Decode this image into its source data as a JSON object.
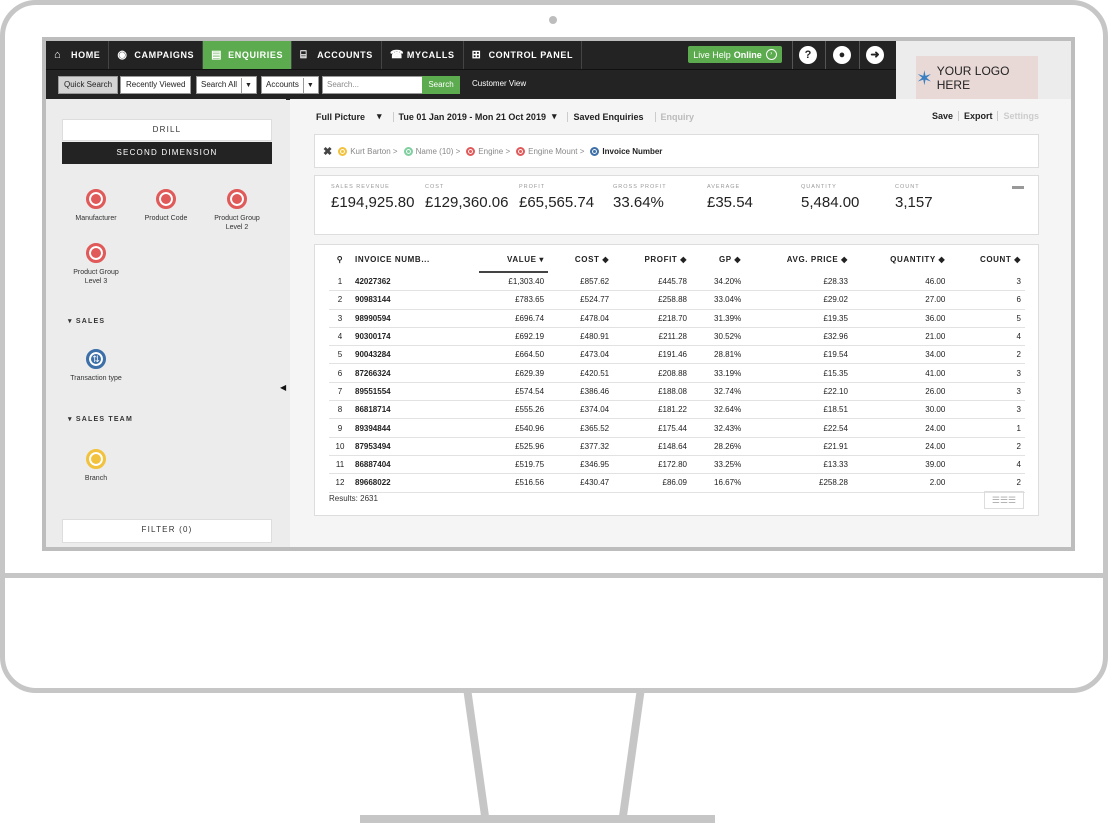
{
  "nav": {
    "items": [
      {
        "label": "HOME",
        "icon": "home-icon",
        "glyph": "⌂"
      },
      {
        "label": "CAMPAIGNS",
        "icon": "campaigns-icon",
        "glyph": "◉"
      },
      {
        "label": "ENQUIRIES",
        "icon": "enquiries-icon",
        "glyph": "▤"
      },
      {
        "label": "ACCOUNTS",
        "icon": "bank-icon",
        "glyph": "⌸"
      },
      {
        "label": "MYCALLS",
        "icon": "calls-icon",
        "glyph": "☎"
      },
      {
        "label": "CONTROL PANEL",
        "icon": "control-panel-icon",
        "glyph": "⊞"
      }
    ],
    "live_help": {
      "text": "Live Help",
      "status": "Online"
    },
    "help_glyph": "?",
    "user_glyph": "●",
    "logout_glyph": "➜"
  },
  "logo": {
    "text": "YOUR LOGO HERE",
    "glyph": "✶"
  },
  "searchbar": {
    "quick_search": "Quick Search",
    "recently_viewed": "Recently Viewed",
    "search_all": "Search All",
    "accounts": "Accounts",
    "placeholder": "Search...",
    "search_button": "Search",
    "customer_view": "Customer View",
    "caret": "▼"
  },
  "left": {
    "drill": "DRILL",
    "second_dimension": "SECOND DIMENSION",
    "dimensions": [
      {
        "label": "Manufacturer"
      },
      {
        "label": "Product Code"
      },
      {
        "label": "Product Group Level 2"
      },
      {
        "label": "Product Group Level 3"
      }
    ],
    "sales_label": "▾ SALES",
    "transaction_type": "Transaction type",
    "sales_team_label": "▾ SALES TEAM",
    "branch": "Branch",
    "filter": "FILTER (0)"
  },
  "toolbar": {
    "full_picture": "Full Picture",
    "caret": "▾",
    "date_range": "Tue 01 Jan 2019 - Mon 21 Oct 2019",
    "saved_enquiries": "Saved Enquiries",
    "enquiry": "Enquiry",
    "save": "Save",
    "export": "Export",
    "settings": "Settings"
  },
  "breadcrumbs": [
    {
      "label": "Kurt Barton",
      "color": "#f2c23e"
    },
    {
      "label": "Name (10)",
      "color": "#7fcf9f"
    },
    {
      "label": "Engine",
      "color": "#e05a5a"
    },
    {
      "label": "Engine Mount",
      "color": "#e05a5a"
    },
    {
      "label": "Invoice Number",
      "color": "#3d6fa8"
    }
  ],
  "crumb_sep": ">",
  "stats": [
    {
      "label": "SALES REVENUE",
      "value": "£194,925.80"
    },
    {
      "label": "COST",
      "value": "£129,360.06"
    },
    {
      "label": "PROFIT",
      "value": "£65,565.74"
    },
    {
      "label": "GROSS PROFIT",
      "value": "33.64%"
    },
    {
      "label": "AVERAGE",
      "value": "£35.54"
    },
    {
      "label": "QUANTITY",
      "value": "5,484.00"
    },
    {
      "label": "COUNT",
      "value": "3,157"
    }
  ],
  "table": {
    "headers": [
      "INVOICE NUMB...",
      "VALUE ▾",
      "COST ◆",
      "PROFIT ◆",
      "GP ◆",
      "AVG. PRICE ◆",
      "QUANTITY ◆",
      "COUNT ◆"
    ],
    "rows": [
      [
        "1",
        "42027362",
        "£1,303.40",
        "£857.62",
        "£445.78",
        "34.20%",
        "£28.33",
        "46.00",
        "3"
      ],
      [
        "2",
        "90983144",
        "£783.65",
        "£524.77",
        "£258.88",
        "33.04%",
        "£29.02",
        "27.00",
        "6"
      ],
      [
        "3",
        "98990594",
        "£696.74",
        "£478.04",
        "£218.70",
        "31.39%",
        "£19.35",
        "36.00",
        "5"
      ],
      [
        "4",
        "90300174",
        "£692.19",
        "£480.91",
        "£211.28",
        "30.52%",
        "£32.96",
        "21.00",
        "4"
      ],
      [
        "5",
        "90043284",
        "£664.50",
        "£473.04",
        "£191.46",
        "28.81%",
        "£19.54",
        "34.00",
        "2"
      ],
      [
        "6",
        "87266324",
        "£629.39",
        "£420.51",
        "£208.88",
        "33.19%",
        "£15.35",
        "41.00",
        "3"
      ],
      [
        "7",
        "89551554",
        "£574.54",
        "£386.46",
        "£188.08",
        "32.74%",
        "£22.10",
        "26.00",
        "3"
      ],
      [
        "8",
        "86818714",
        "£555.26",
        "£374.04",
        "£181.22",
        "32.64%",
        "£18.51",
        "30.00",
        "3"
      ],
      [
        "9",
        "89394844",
        "£540.96",
        "£365.52",
        "£175.44",
        "32.43%",
        "£22.54",
        "24.00",
        "1"
      ],
      [
        "10",
        "87953494",
        "£525.96",
        "£377.32",
        "£148.64",
        "28.26%",
        "£21.91",
        "24.00",
        "2"
      ],
      [
        "11",
        "86887404",
        "£519.75",
        "£346.95",
        "£172.80",
        "33.25%",
        "£13.33",
        "39.00",
        "4"
      ],
      [
        "12",
        "89668022",
        "£516.56",
        "£430.47",
        "£86.09",
        "16.67%",
        "£258.28",
        "2.00",
        "2"
      ]
    ],
    "results": "Results: 2631"
  }
}
